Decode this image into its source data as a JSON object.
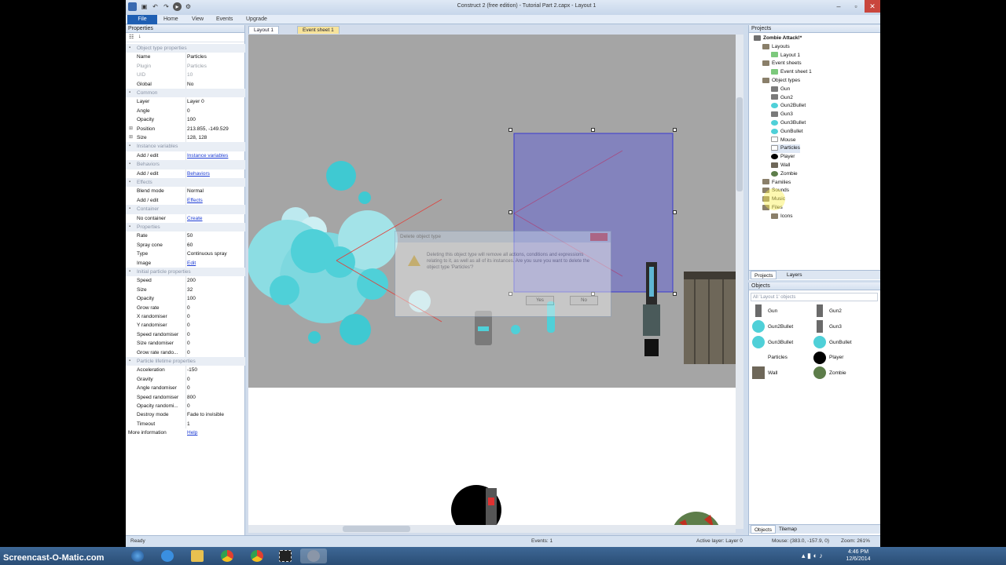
{
  "app": {
    "title": "Construct 2  (free edition) - Tutorial Part 2.capx - Layout 1",
    "ribbon_tabs": [
      "File",
      "Home",
      "View",
      "Events",
      "Upgrade"
    ]
  },
  "properties": {
    "title": "Properties",
    "rows": [
      {
        "type": "cat",
        "k": "Object type properties"
      },
      {
        "k": "Name",
        "v": "Particles"
      },
      {
        "k": "Plugin",
        "v": "Particles",
        "dim": true
      },
      {
        "k": "UID",
        "v": "10",
        "dim": true
      },
      {
        "k": "Global",
        "v": "No"
      },
      {
        "type": "cat",
        "k": "Common"
      },
      {
        "k": "Layer",
        "v": "Layer 0"
      },
      {
        "k": "Angle",
        "v": "0"
      },
      {
        "k": "Opacity",
        "v": "100"
      },
      {
        "k": "Position",
        "v": "213.855, -149.529",
        "tog": "+"
      },
      {
        "k": "Size",
        "v": "128, 128",
        "tog": "+"
      },
      {
        "type": "cat",
        "k": "Instance variables"
      },
      {
        "k": "Add / edit",
        "v": "Instance variables",
        "link": true
      },
      {
        "type": "cat",
        "k": "Behaviors"
      },
      {
        "k": "Add / edit",
        "v": "Behaviors",
        "link": true
      },
      {
        "type": "cat",
        "k": "Effects"
      },
      {
        "k": "Blend mode",
        "v": "Normal"
      },
      {
        "k": "Add / edit",
        "v": "Effects",
        "link": true
      },
      {
        "type": "cat",
        "k": "Container"
      },
      {
        "k": "No container",
        "v": "Create",
        "link": true
      },
      {
        "type": "cat",
        "k": "Properties"
      },
      {
        "k": "Rate",
        "v": "50"
      },
      {
        "k": "Spray cone",
        "v": "60"
      },
      {
        "k": "Type",
        "v": "Continuous spray"
      },
      {
        "k": "Image",
        "v": "Edit",
        "link": true
      },
      {
        "type": "cat",
        "k": "Initial particle properties"
      },
      {
        "k": "Speed",
        "v": "200"
      },
      {
        "k": "Size",
        "v": "32"
      },
      {
        "k": "Opacity",
        "v": "100"
      },
      {
        "k": "Grow rate",
        "v": "0"
      },
      {
        "k": "X randomiser",
        "v": "0"
      },
      {
        "k": "Y randomiser",
        "v": "0"
      },
      {
        "k": "Speed randomiser",
        "v": "0"
      },
      {
        "k": "Size randomiser",
        "v": "0"
      },
      {
        "k": "Grow rate rando...",
        "v": "0"
      },
      {
        "type": "cat",
        "k": "Particle lifetime properties"
      },
      {
        "k": "Acceleration",
        "v": "-150"
      },
      {
        "k": "Gravity",
        "v": "0"
      },
      {
        "k": "Angle randomiser",
        "v": "0"
      },
      {
        "k": "Speed randomiser",
        "v": "800"
      },
      {
        "k": "Opacity randomi...",
        "v": "0"
      },
      {
        "k": "Destroy mode",
        "v": "Fade to invisible"
      },
      {
        "k": "Timeout",
        "v": "1"
      },
      {
        "type": "more",
        "k": "More information",
        "v": "Help",
        "link": true
      }
    ]
  },
  "editor_tabs": [
    "Layout 1",
    "Event sheet 1"
  ],
  "dialog": {
    "title": "Delete object type",
    "message": "Deleting this object type will remove all actions, conditions and expressions relating to it, as well as all of its instances. Are you sure you want to delete the object type 'Particles'?",
    "yes": "Yes",
    "no": "No"
  },
  "projects": {
    "title": "Projects",
    "items": [
      {
        "label": "Zombie Attack!*",
        "level": 0,
        "icon": "project",
        "bold": true
      },
      {
        "label": "Layouts",
        "level": 1,
        "icon": "folder"
      },
      {
        "label": "Layout 1",
        "level": 2,
        "icon": "sheet"
      },
      {
        "label": "Event sheets",
        "level": 1,
        "icon": "folder"
      },
      {
        "label": "Event sheet 1",
        "level": 2,
        "icon": "sheet"
      },
      {
        "label": "Object types",
        "level": 1,
        "icon": "folder"
      },
      {
        "label": "Gun",
        "level": 2,
        "icon": "gun"
      },
      {
        "label": "Gun2",
        "level": 2,
        "icon": "gun"
      },
      {
        "label": "Gun2Bullet",
        "level": 2,
        "icon": "bullet"
      },
      {
        "label": "Gun3",
        "level": 2,
        "icon": "gun"
      },
      {
        "label": "Gun3Bullet",
        "level": 2,
        "icon": "bullet"
      },
      {
        "label": "GunBullet",
        "level": 2,
        "icon": "bullet"
      },
      {
        "label": "Mouse",
        "level": 2,
        "icon": "mouse"
      },
      {
        "label": "Particles",
        "level": 2,
        "icon": "particles",
        "selected": true
      },
      {
        "label": "Player",
        "level": 2,
        "icon": "player"
      },
      {
        "label": "Wall",
        "level": 2,
        "icon": "wall"
      },
      {
        "label": "Zombie",
        "level": 2,
        "icon": "zombie"
      },
      {
        "label": "Families",
        "level": 1,
        "icon": "folder"
      },
      {
        "label": "Sounds",
        "level": 1,
        "icon": "folder"
      },
      {
        "label": "Music",
        "level": 1,
        "icon": "folder"
      },
      {
        "label": "Files",
        "level": 1,
        "icon": "folder"
      },
      {
        "label": "Icons",
        "level": 2,
        "icon": "folder"
      }
    ],
    "tabs": [
      "Projects",
      "Layers"
    ]
  },
  "objects": {
    "title": "Objects",
    "filter": "All 'Layout 1' objects",
    "items": [
      {
        "label": "Gun",
        "icon": "gun"
      },
      {
        "label": "Gun2",
        "icon": "gun"
      },
      {
        "label": "Gun2Bullet",
        "icon": "bullet"
      },
      {
        "label": "Gun3",
        "icon": "gun"
      },
      {
        "label": "Gun3Bullet",
        "icon": "bullet"
      },
      {
        "label": "GunBullet",
        "icon": "bullet"
      },
      {
        "label": "Particles",
        "icon": "particles"
      },
      {
        "label": "Player",
        "icon": "player"
      },
      {
        "label": "Wall",
        "icon": "wall"
      },
      {
        "label": "Zombie",
        "icon": "zombie"
      }
    ],
    "tabs": [
      "Objects",
      "Tilemap"
    ]
  },
  "status": {
    "ready": "Ready",
    "events": "Events: 1",
    "layer": "Active layer: Layer 0",
    "mouse": "Mouse: (383.0, -157.9, 0)",
    "zoom": "Zoom: 261%"
  },
  "taskbar": {
    "time": "4:46 PM",
    "date": "12/6/2014"
  },
  "watermark": "Screencast-O-Matic.com",
  "colors": {
    "accent": "#1f5fb3",
    "selection": "#5a5adc",
    "particle": "#4fd0d8"
  }
}
